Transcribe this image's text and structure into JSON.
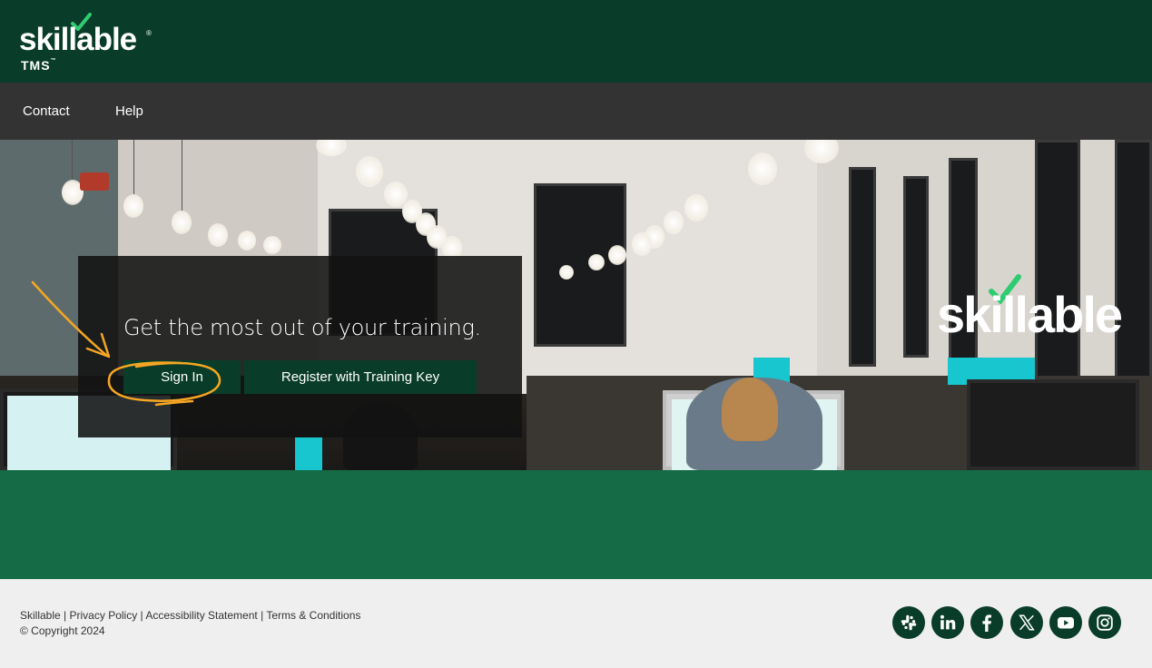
{
  "header": {
    "logo_text": "skillable",
    "logo_registered": "®",
    "logo_product": "TMS",
    "logo_product_tm": "™"
  },
  "nav": {
    "items": [
      {
        "label": "Contact"
      },
      {
        "label": "Help"
      }
    ]
  },
  "hero": {
    "brand_mark": "skillable",
    "tagline": "Get the most out of your training.",
    "sign_in_label": "Sign In",
    "register_label": "Register with Training Key"
  },
  "footer": {
    "links": [
      {
        "label": "Skillable"
      },
      {
        "label": "Privacy Policy"
      },
      {
        "label": "Accessibility Statement"
      },
      {
        "label": "Terms & Conditions"
      }
    ],
    "separator": "|",
    "copyright": "© Copyright 2024",
    "social": [
      {
        "icon": "slack-icon"
      },
      {
        "icon": "linkedin-icon"
      },
      {
        "icon": "facebook-icon"
      },
      {
        "icon": "x-twitter-icon"
      },
      {
        "icon": "youtube-icon"
      },
      {
        "icon": "instagram-icon"
      }
    ]
  },
  "colors": {
    "header_bg": "#0a3d29",
    "nav_bg": "#333333",
    "button_bg": "#0a3d29",
    "band_bg": "#146b45",
    "footer_bg": "#efefef",
    "annotation": "#f5a623"
  }
}
